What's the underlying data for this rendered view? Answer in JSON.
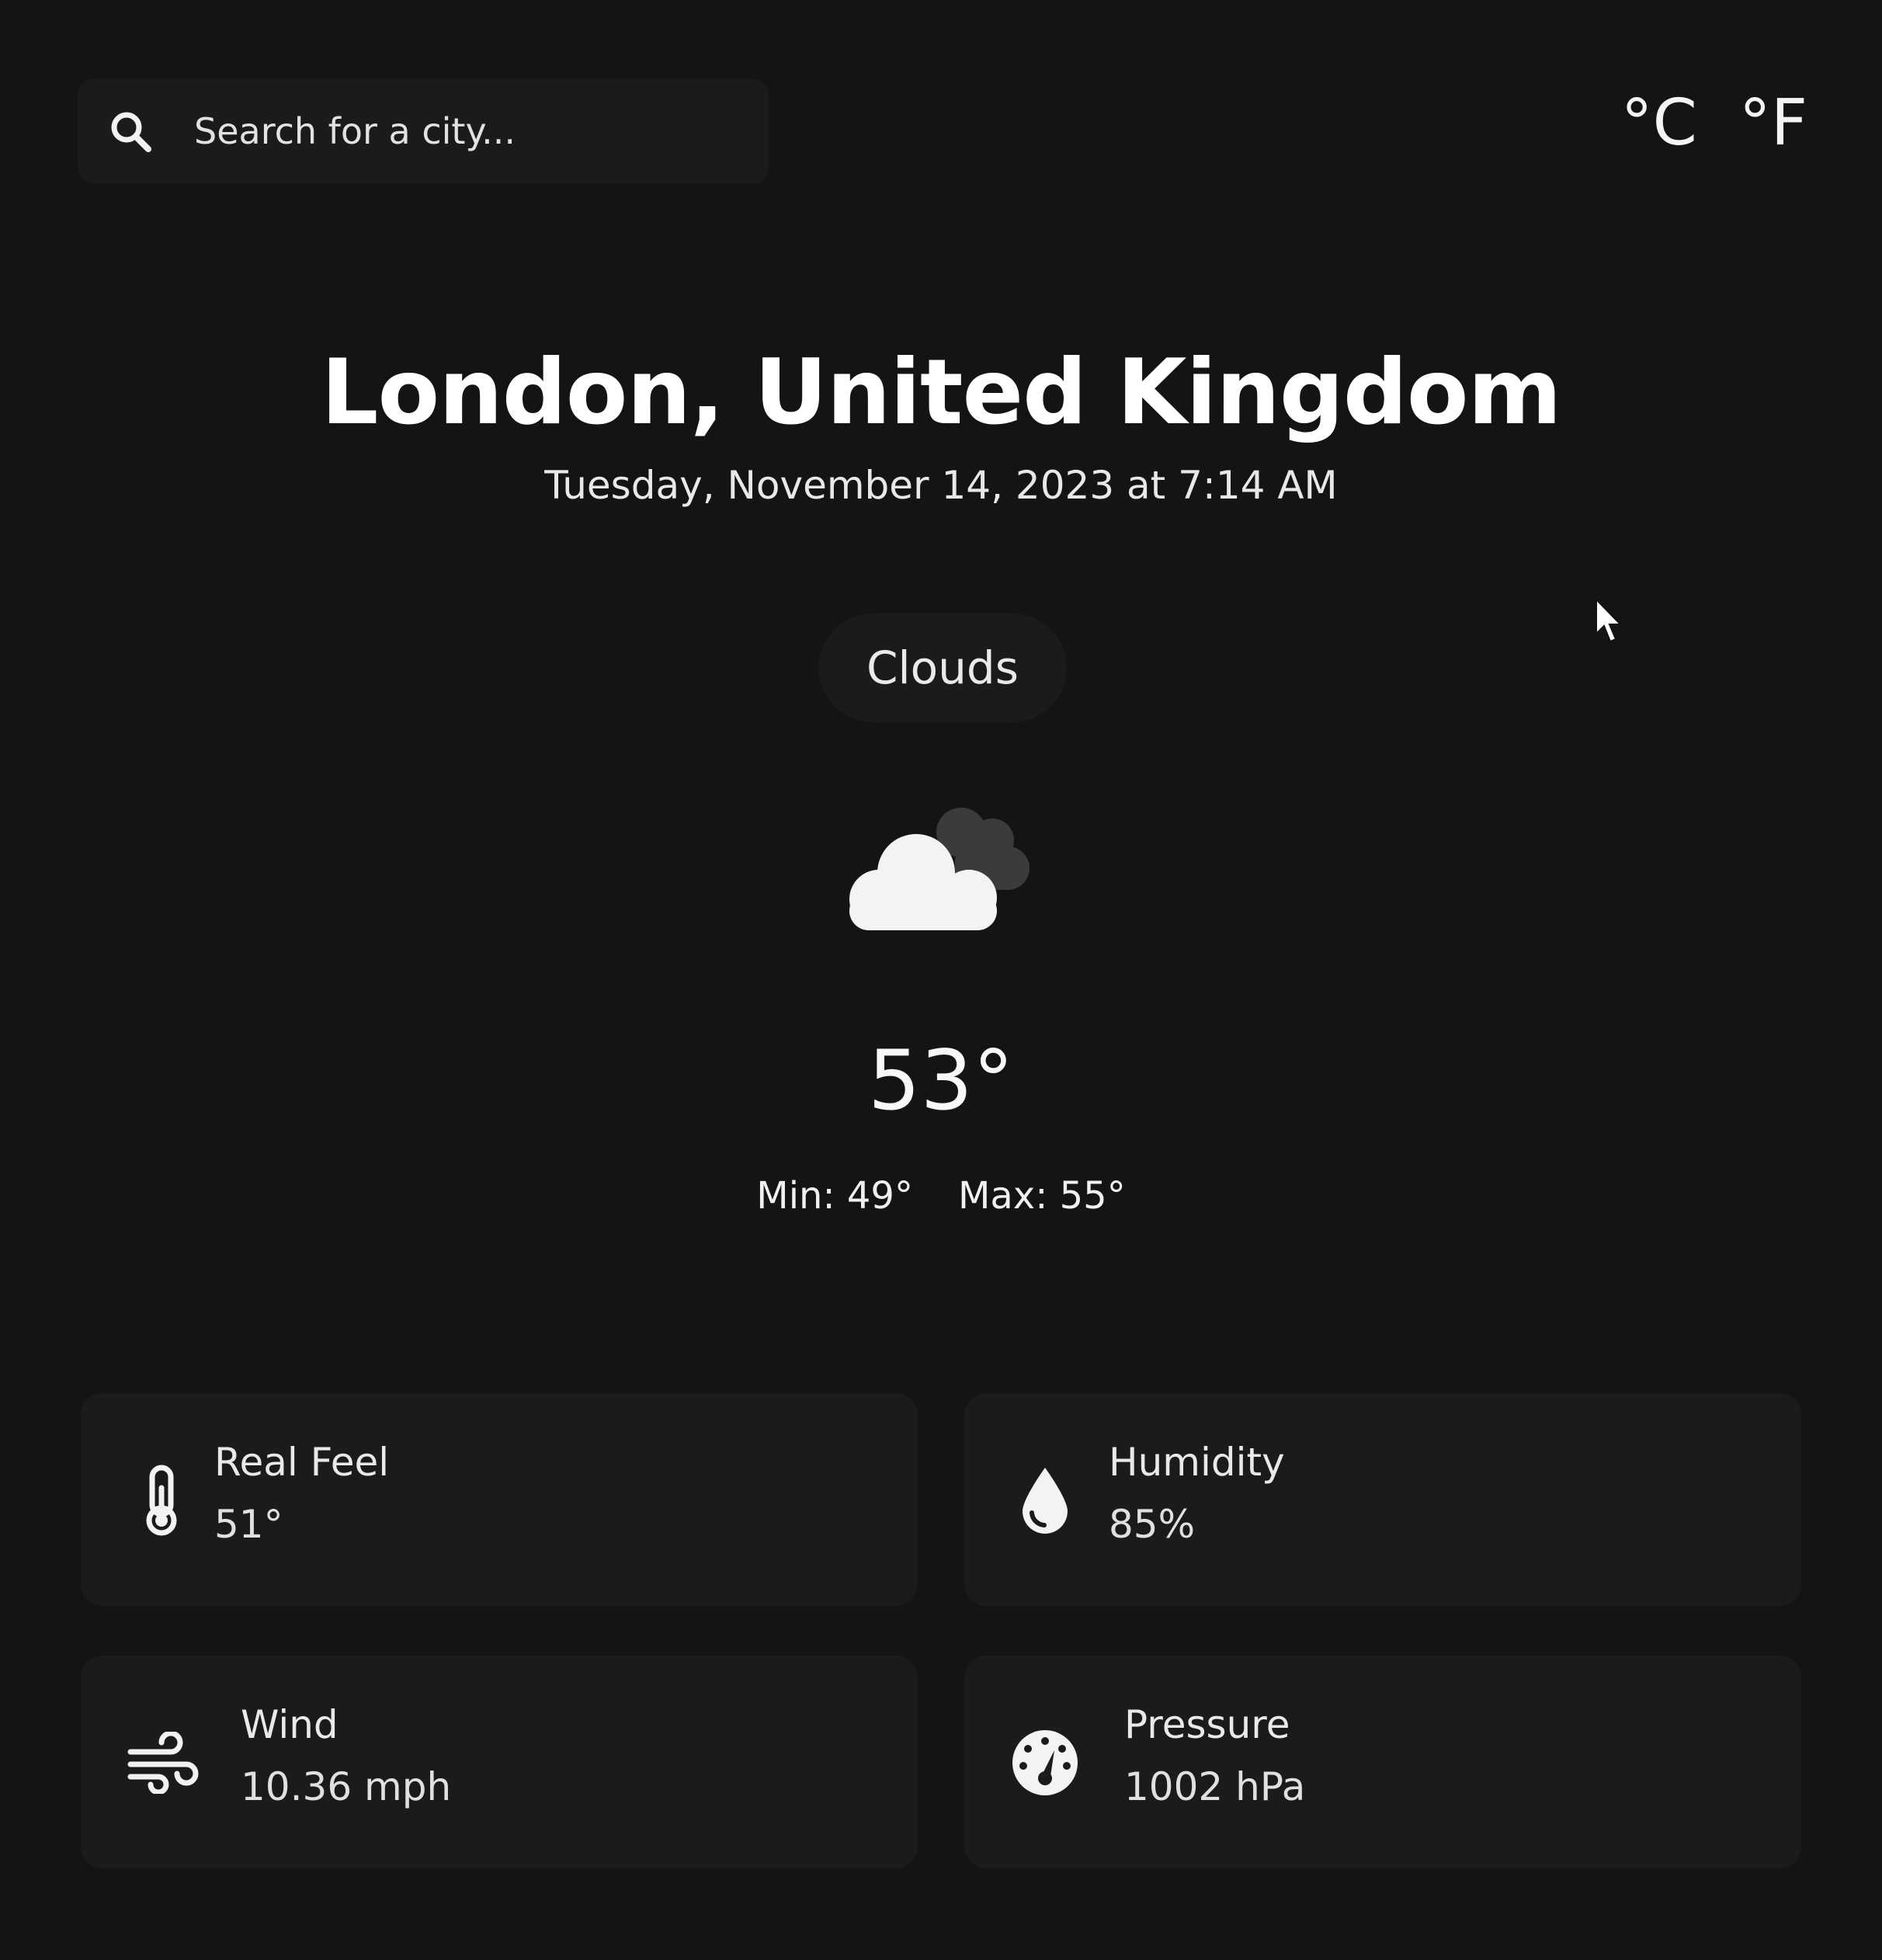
{
  "search": {
    "placeholder": "Search for a city..."
  },
  "units": {
    "celsius": "°C",
    "fahrenheit": "°F"
  },
  "location": {
    "city": "London, United Kingdom",
    "datetime": "Tuesday, November 14, 2023 at 7:14 AM"
  },
  "current": {
    "condition": "Clouds",
    "icon": "cloud-icon",
    "temperature": "53°",
    "min": "Min: 49°",
    "max": "Max: 55°"
  },
  "details": {
    "real_feel": {
      "label": "Real Feel",
      "value": "51°",
      "icon": "thermometer-icon"
    },
    "humidity": {
      "label": "Humidity",
      "value": "85%",
      "icon": "droplet-icon"
    },
    "wind": {
      "label": "Wind",
      "value": "10.36 mph",
      "icon": "wind-icon"
    },
    "pressure": {
      "label": "Pressure",
      "value": "1002 hPa",
      "icon": "gauge-icon"
    }
  },
  "colors": {
    "background": "#141415",
    "surface": "#1b1b1c",
    "text": "#ffffff"
  }
}
